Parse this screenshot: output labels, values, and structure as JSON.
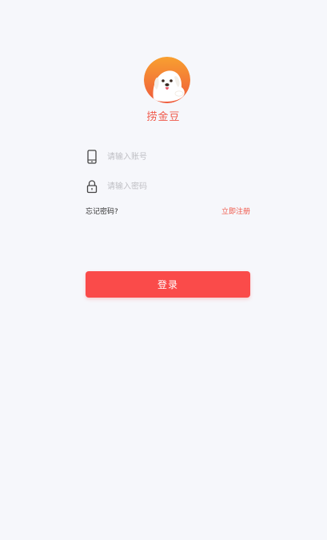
{
  "app": {
    "name": "捞金豆"
  },
  "login_form": {
    "account_placeholder": "请输入账号",
    "password_placeholder": "请输入密码",
    "forgot_password": "忘记密码?",
    "register": "立即注册",
    "submit_label": "登录"
  },
  "icons": {
    "logo": "dog-mascot-icon",
    "account": "phone-icon",
    "password": "lock-icon"
  },
  "colors": {
    "background": "#f6f7fb",
    "accent": "#fa4b4a",
    "brand_text": "#f0584a",
    "logo_gradient_top": "#f8a030",
    "logo_gradient_bottom": "#ef5a3c"
  }
}
